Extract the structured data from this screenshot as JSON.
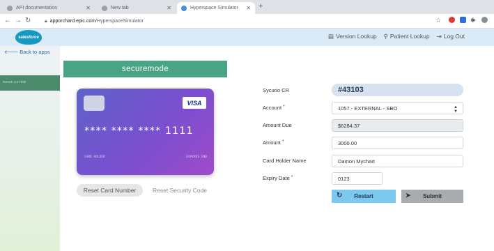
{
  "browser": {
    "tabs": [
      {
        "title": "API documentation"
      },
      {
        "title": "New tab"
      },
      {
        "title": "Hyperspace Simulator"
      }
    ],
    "new_tab": "+",
    "url_host": "apporchard.epic.com",
    "url_path": "/HyperspaceSimulator"
  },
  "header": {
    "logo_text": "salesforce",
    "version_lookup": "Version Lookup",
    "patient_lookup": "Patient Lookup",
    "log_out": "Log Out"
  },
  "sidebar": {
    "back_link": "Back to apps",
    "band_label": "IMAGE not FINE"
  },
  "secure_banner": "securemode",
  "card": {
    "brand": "VISA",
    "number": "**** **** **** 1111",
    "holder_label": "CARD HOLDER",
    "expiry_label": "EXPIRES END"
  },
  "card_actions": {
    "reset_card": "Reset Card Number",
    "reset_security": "Reset Security Code"
  },
  "form": {
    "sycurio_cr_label": "Sycurio CR",
    "sycurio_cr_value": "#43103",
    "account_label": "Account",
    "account_value": "1057 - EXTERNAL - SBO",
    "amount_due_label": "Amount Due",
    "amount_due_value": "$6284.37",
    "amount_label": "Amount",
    "amount_value": "3000.00",
    "card_holder_label": "Card Holder Name",
    "card_holder_value": "Damon Mychart",
    "expiry_label": "Expiry Date",
    "expiry_value": "0123",
    "required_mark": "*"
  },
  "buttons": {
    "restart": "Restart",
    "submit": "Submit"
  }
}
